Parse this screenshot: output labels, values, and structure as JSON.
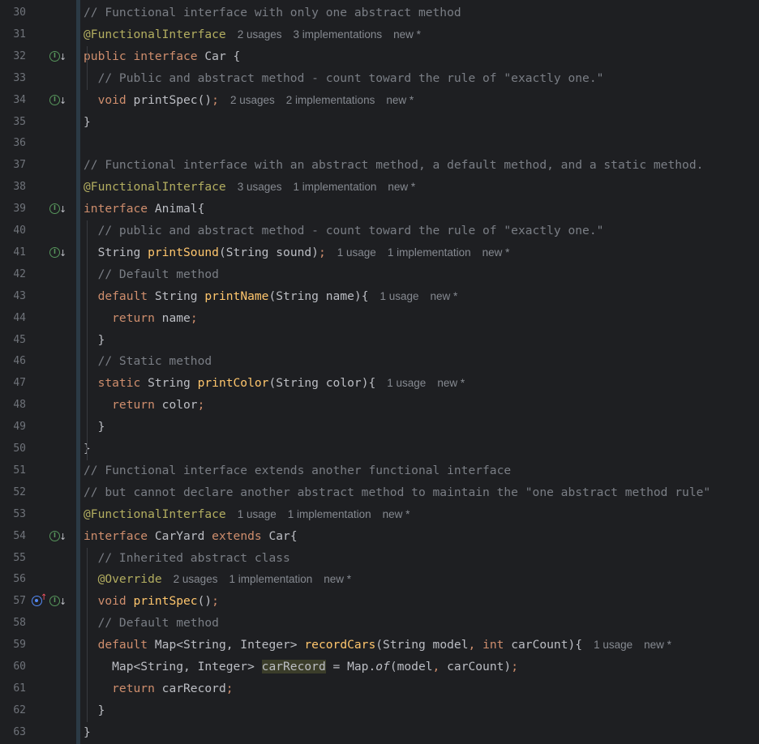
{
  "lines": [
    {
      "n": "30",
      "icons": [],
      "tokens": [
        {
          "c": "cm",
          "t": "// Functional interface with only one abstract method"
        }
      ]
    },
    {
      "n": "31",
      "icons": [],
      "tokens": [
        {
          "c": "an",
          "t": "@FunctionalInterface"
        }
      ],
      "hints": [
        "2 usages",
        "3 implementations",
        "new *"
      ]
    },
    {
      "n": "32",
      "icons": [
        "implemented-icon"
      ],
      "tokens": [
        {
          "c": "kw",
          "t": "public interface "
        },
        {
          "c": "tx",
          "t": "Car {"
        }
      ]
    },
    {
      "n": "33",
      "icons": [],
      "tokens": [
        {
          "c": "cm",
          "t": "  // Public and abstract method - count toward the rule of \"exactly one.\""
        }
      ]
    },
    {
      "n": "34",
      "icons": [
        "implemented-icon"
      ],
      "tokens": [
        {
          "c": "kw",
          "t": "  void "
        },
        {
          "c": "tx",
          "t": "printSpec()"
        },
        {
          "c": "kw",
          "t": ";"
        }
      ],
      "hints": [
        "2 usages",
        "2 implementations",
        "new *"
      ]
    },
    {
      "n": "35",
      "icons": [],
      "tokens": [
        {
          "c": "tx",
          "t": "}"
        }
      ]
    },
    {
      "n": "36",
      "icons": [],
      "tokens": []
    },
    {
      "n": "37",
      "icons": [],
      "tokens": [
        {
          "c": "cm",
          "t": "// Functional interface with an abstract method, a default method, and a static method."
        }
      ]
    },
    {
      "n": "38",
      "icons": [],
      "tokens": [
        {
          "c": "an",
          "t": "@FunctionalInterface"
        }
      ],
      "hints": [
        "3 usages",
        "1 implementation",
        "new *"
      ]
    },
    {
      "n": "39",
      "icons": [
        "implemented-icon"
      ],
      "tokens": [
        {
          "c": "kw",
          "t": "interface "
        },
        {
          "c": "tx",
          "t": "Animal{"
        }
      ]
    },
    {
      "n": "40",
      "icons": [],
      "tokens": [
        {
          "c": "cm",
          "t": "  // public and abstract method - count toward the rule of \"exactly one.\""
        }
      ]
    },
    {
      "n": "41",
      "icons": [
        "implemented-icon"
      ],
      "tokens": [
        {
          "c": "tx",
          "t": "  String "
        },
        {
          "c": "fn",
          "t": "printSound"
        },
        {
          "c": "tx",
          "t": "(String sound)"
        },
        {
          "c": "kw",
          "t": ";"
        }
      ],
      "hints": [
        "1 usage",
        "1 implementation",
        "new *"
      ]
    },
    {
      "n": "42",
      "icons": [],
      "tokens": [
        {
          "c": "cm",
          "t": "  // Default method"
        }
      ]
    },
    {
      "n": "43",
      "icons": [],
      "tokens": [
        {
          "c": "kw",
          "t": "  default "
        },
        {
          "c": "tx",
          "t": "String "
        },
        {
          "c": "fn",
          "t": "printName"
        },
        {
          "c": "tx",
          "t": "(String name){"
        }
      ],
      "hints": [
        "1 usage",
        "new *"
      ]
    },
    {
      "n": "44",
      "icons": [],
      "tokens": [
        {
          "c": "kw",
          "t": "    return "
        },
        {
          "c": "tx",
          "t": "name"
        },
        {
          "c": "kw",
          "t": ";"
        }
      ]
    },
    {
      "n": "45",
      "icons": [],
      "tokens": [
        {
          "c": "tx",
          "t": "  }"
        }
      ]
    },
    {
      "n": "46",
      "icons": [],
      "tokens": [
        {
          "c": "cm",
          "t": "  // Static method"
        }
      ]
    },
    {
      "n": "47",
      "icons": [],
      "tokens": [
        {
          "c": "kw",
          "t": "  static "
        },
        {
          "c": "tx",
          "t": "String "
        },
        {
          "c": "fn",
          "t": "printColor"
        },
        {
          "c": "tx",
          "t": "(String color){"
        }
      ],
      "hints": [
        "1 usage",
        "new *"
      ]
    },
    {
      "n": "48",
      "icons": [],
      "tokens": [
        {
          "c": "kw",
          "t": "    return "
        },
        {
          "c": "tx",
          "t": "color"
        },
        {
          "c": "kw",
          "t": ";"
        }
      ]
    },
    {
      "n": "49",
      "icons": [],
      "tokens": [
        {
          "c": "tx",
          "t": "  }"
        }
      ]
    },
    {
      "n": "50",
      "icons": [],
      "tokens": [
        {
          "c": "tx",
          "t": "}"
        }
      ]
    },
    {
      "n": "51",
      "icons": [],
      "tokens": [
        {
          "c": "cm",
          "t": "// Functional interface extends another functional interface"
        }
      ]
    },
    {
      "n": "52",
      "icons": [],
      "tokens": [
        {
          "c": "cm",
          "t": "// but cannot declare another abstract method to maintain the \"one abstract method rule\""
        }
      ]
    },
    {
      "n": "53",
      "icons": [],
      "tokens": [
        {
          "c": "an",
          "t": "@FunctionalInterface"
        }
      ],
      "hints": [
        "1 usage",
        "1 implementation",
        "new *"
      ]
    },
    {
      "n": "54",
      "icons": [
        "implemented-icon"
      ],
      "tokens": [
        {
          "c": "kw",
          "t": "interface "
        },
        {
          "c": "tx",
          "t": "CarYard "
        },
        {
          "c": "kw",
          "t": "extends "
        },
        {
          "c": "tx",
          "t": "Car{"
        }
      ]
    },
    {
      "n": "55",
      "icons": [],
      "tokens": [
        {
          "c": "cm",
          "t": "  // Inherited abstract class"
        }
      ]
    },
    {
      "n": "56",
      "icons": [],
      "tokens": [
        {
          "c": "an",
          "t": "  @Override"
        }
      ],
      "hints": [
        "2 usages",
        "1 implementation",
        "new *"
      ]
    },
    {
      "n": "57",
      "icons": [
        "overrides-icon",
        "implemented-icon"
      ],
      "tokens": [
        {
          "c": "kw",
          "t": "  void "
        },
        {
          "c": "fn",
          "t": "printSpec"
        },
        {
          "c": "tx",
          "t": "()"
        },
        {
          "c": "kw",
          "t": ";"
        }
      ]
    },
    {
      "n": "58",
      "icons": [],
      "tokens": [
        {
          "c": "cm",
          "t": "  // Default method"
        }
      ]
    },
    {
      "n": "59",
      "icons": [],
      "tokens": [
        {
          "c": "kw",
          "t": "  default "
        },
        {
          "c": "tx",
          "t": "Map<String, Integer> "
        },
        {
          "c": "fn",
          "t": "recordCars"
        },
        {
          "c": "tx",
          "t": "(String model"
        },
        {
          "c": "kw",
          "t": ", int "
        },
        {
          "c": "tx",
          "t": "carCount){"
        }
      ],
      "hints": [
        "1 usage",
        "new *"
      ]
    },
    {
      "n": "60",
      "icons": [],
      "tokens": [
        {
          "c": "tx",
          "t": "    Map<String, Integer> "
        },
        {
          "c": "tx hl",
          "t": "carRecord"
        },
        {
          "c": "tx",
          "t": " = Map."
        },
        {
          "c": "tx",
          "t": "of"
        },
        {
          "c": "tx",
          "t": "(model"
        },
        {
          "c": "kw",
          "t": ", "
        },
        {
          "c": "tx",
          "t": "carCount)"
        },
        {
          "c": "kw",
          "t": ";"
        }
      ]
    },
    {
      "n": "61",
      "icons": [],
      "tokens": [
        {
          "c": "kw",
          "t": "    return "
        },
        {
          "c": "tx",
          "t": "carRecord"
        },
        {
          "c": "kw",
          "t": ";"
        }
      ]
    },
    {
      "n": "62",
      "icons": [],
      "tokens": [
        {
          "c": "tx",
          "t": "  }"
        }
      ]
    },
    {
      "n": "63",
      "icons": [],
      "tokens": [
        {
          "c": "tx",
          "t": "}"
        }
      ]
    }
  ]
}
